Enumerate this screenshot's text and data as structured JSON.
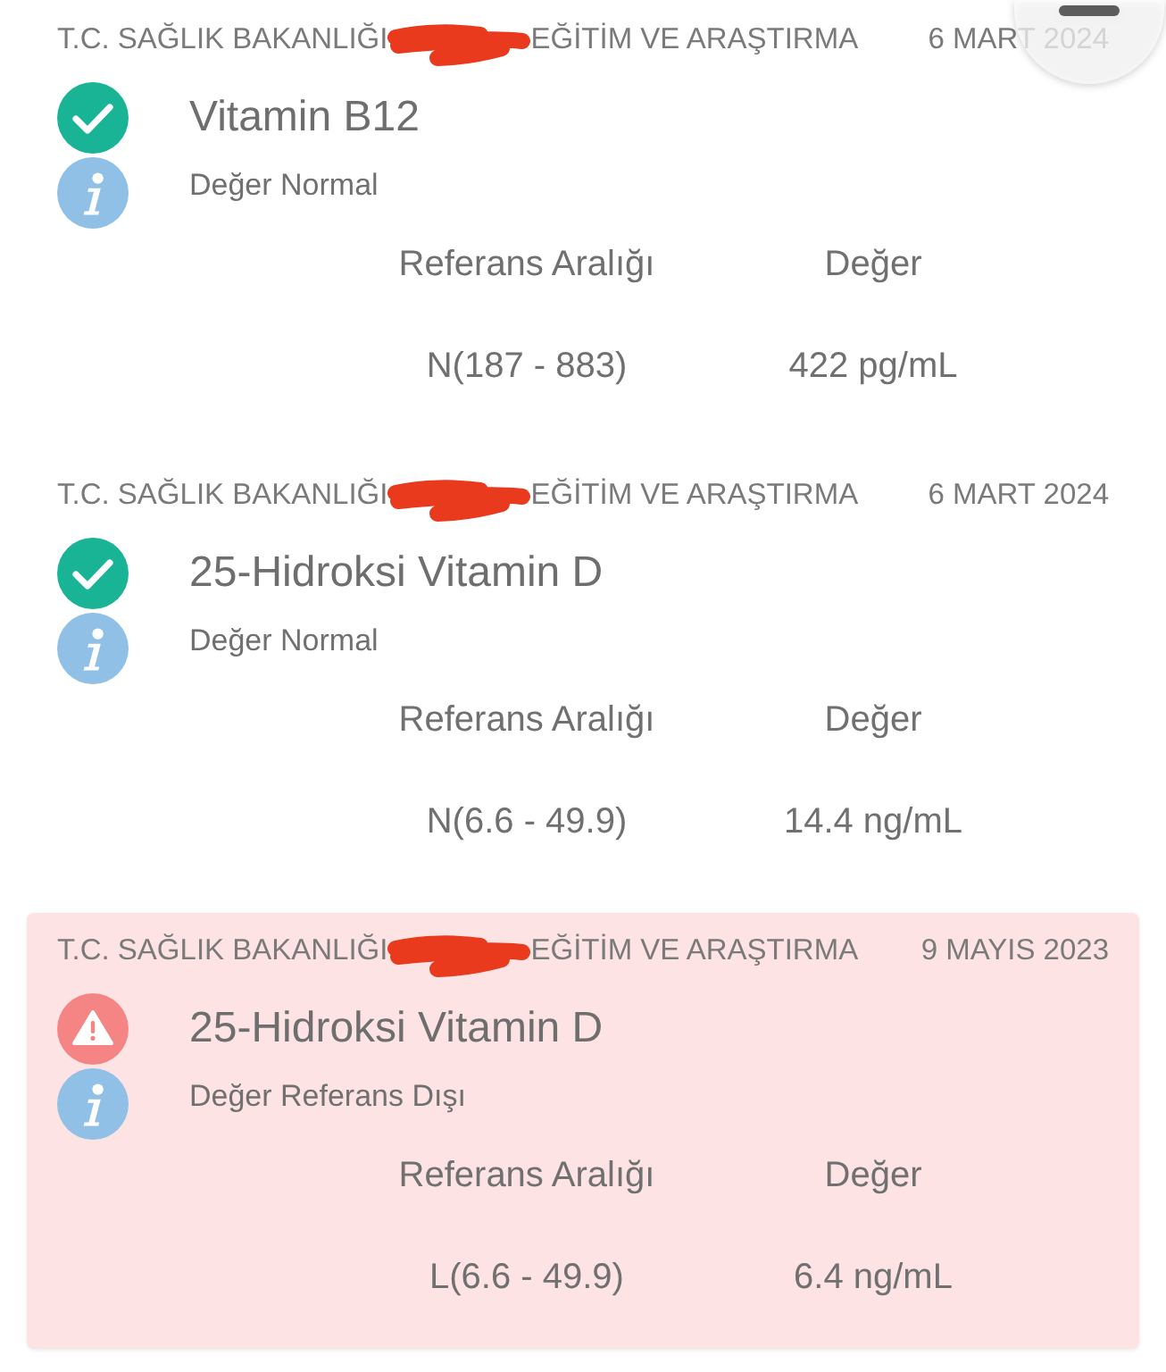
{
  "results": [
    {
      "institution_start": "T.C. SAĞLIK BAKANLIĞI",
      "redacted": true,
      "institution_end": "EĞİTİM VE ARAŞTIRMA",
      "date": "6 MART 2024",
      "kind": "normal",
      "test": "Vitamin B12",
      "note": "Değer Normal",
      "columns": [
        "Referans Aralığı",
        "Değer"
      ],
      "reference_range": "N(187 - 883)",
      "value": "422 pg/mL"
    },
    {
      "institution_start": "T.C. SAĞLIK BAKANLIĞI",
      "redacted": true,
      "institution_end": "EĞİTİM VE ARAŞTIRMA",
      "date": "6 MART 2024",
      "kind": "normal",
      "test": "25-Hidroksi Vitamin D",
      "note": "Değer Normal",
      "columns": [
        "Referans Aralığı",
        "Değer"
      ],
      "reference_range": "N(6.6 - 49.9)",
      "value": "14.4 ng/mL"
    },
    {
      "institution_start": "T.C. SAĞLIK BAKANLIĞI",
      "redacted": true,
      "institution_end": "EĞİTİM VE ARAŞTIRMA",
      "date": "9 MAYIS 2023",
      "kind": "alert",
      "test": "25-Hidroksi Vitamin D",
      "note": "Değer Referans Dışı",
      "columns": [
        "Referans Aralığı",
        "Değer"
      ],
      "reference_range": "L(6.6 - 49.9)",
      "value": "6.4 ng/mL"
    }
  ]
}
